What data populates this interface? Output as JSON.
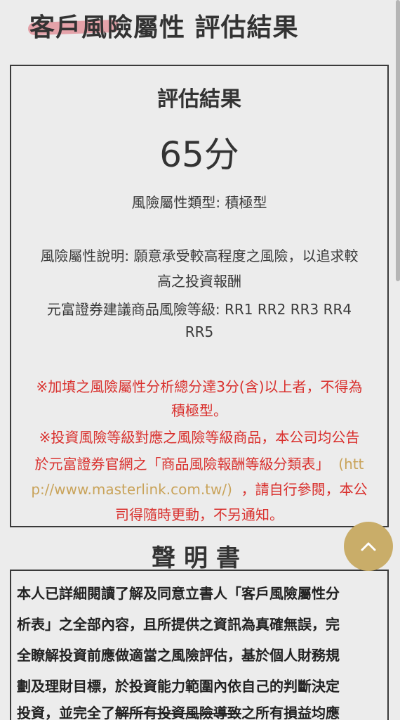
{
  "header": {
    "title": "客戶風險屬性 評估結果"
  },
  "result": {
    "heading": "評估結果",
    "score": "65分",
    "type_line": "風險屬性類型: 積極型",
    "desc_line1": "風險屬性說明: 願意承受較高程度之風險，以追求較",
    "desc_line2": "高之投資報酬",
    "rec_line1": "元富證券建議商品風險等級: RR1 RR2 RR3 RR4",
    "rec_line2": "RR5",
    "note1_line1": "※加填之風險屬性分析總分達3分(含)以上者，不得為",
    "note1_line2": "積極型。",
    "note2_line1": "※投資風險等級對應之風險等級商品，本公司均公告",
    "note2_line2_a": "於元富證券官網之「商品風險報酬等級分類表」",
    "note2_line2_b": "(htt",
    "note2_line3_a": "p://www.masterlink.com.tw/)",
    "note2_line3_b": "，請自行參閱，本公",
    "note2_line4": "司得隨時更動，不另通知。"
  },
  "declaration": {
    "title": "聲明書",
    "line1": "本人已詳細閱讀了解及同意立書人「客戶風險屬性分",
    "line2": "析表」之全部內容，且所提供之資訊為真確無誤，完",
    "line3": "全瞭解投資前應做適當之風險評估，基於個人財務規",
    "line4": "劃及理財目標，於投資能力範圍內依自己的判斷決定",
    "line5_a": "投資，並完全了",
    "line5_b": "解所有投資風險導致",
    "line5_c": "之所有損益均應"
  },
  "colors": {
    "background": "#ececec",
    "warning_red": "#d9302d",
    "link_gold": "#c9a35a",
    "button_gold": "#c9ad69",
    "title_highlight": "#e28a93"
  },
  "icons": {
    "scroll_top": "chevron-up-icon"
  }
}
